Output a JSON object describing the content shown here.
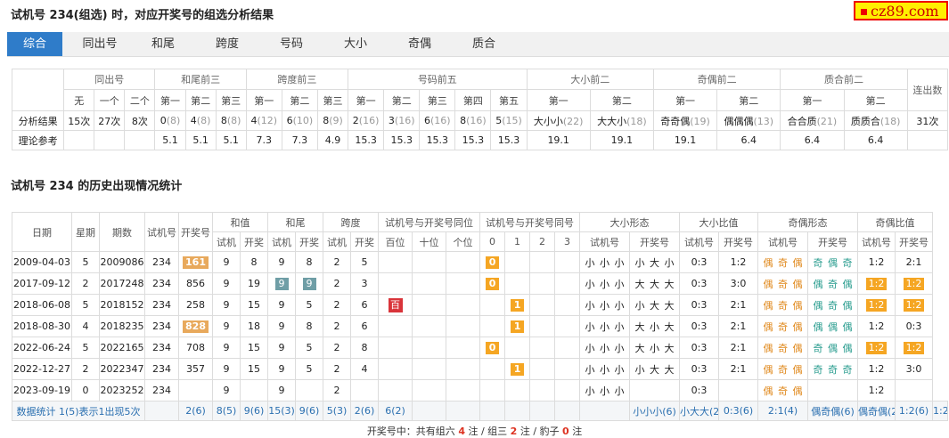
{
  "header": {
    "title": "试机号 234(组选) 时，对应开奖号的组选分析结果",
    "logo": "cz89.com"
  },
  "tabs": [
    "综合",
    "同出号",
    "和尾",
    "跨度",
    "号码",
    "大小",
    "奇偶",
    "质合"
  ],
  "analysis": {
    "groups": [
      "同出号",
      "和尾前三",
      "跨度前三",
      "号码前五",
      "大小前二",
      "奇偶前二",
      "质合前二",
      "连出数"
    ],
    "sub": [
      "无",
      "一个",
      "二个",
      "第一",
      "第二",
      "第三",
      "第一",
      "第二",
      "第三",
      "第一",
      "第二",
      "第三",
      "第四",
      "第五",
      "第一",
      "第二",
      "第一",
      "第二",
      "第一",
      "第二"
    ],
    "row1_label": "分析结果",
    "row1": [
      {
        "v": "15次"
      },
      {
        "v": "27次"
      },
      {
        "v": "8次"
      },
      {
        "v": "0",
        "c": "(8)"
      },
      {
        "v": "4",
        "c": "(8)"
      },
      {
        "v": "8",
        "c": "(8)"
      },
      {
        "v": "4",
        "c": "(12)"
      },
      {
        "v": "6",
        "c": "(10)"
      },
      {
        "v": "8",
        "c": "(9)"
      },
      {
        "v": "2",
        "c": "(16)"
      },
      {
        "v": "3",
        "c": "(16)"
      },
      {
        "v": "6",
        "c": "(16)"
      },
      {
        "v": "8",
        "c": "(16)"
      },
      {
        "v": "5",
        "c": "(15)"
      },
      {
        "v": "大小小",
        "c": "(22)"
      },
      {
        "v": "大大小",
        "c": "(18)"
      },
      {
        "v": "奇奇偶",
        "c": "(19)"
      },
      {
        "v": "偶偶偶",
        "c": "(13)"
      },
      {
        "v": "合合质",
        "c": "(21)"
      },
      {
        "v": "质质合",
        "c": "(18)"
      },
      {
        "v": "31次"
      }
    ],
    "row2_label": "理论参考",
    "row2": [
      "",
      "",
      "",
      "5.1",
      "5.1",
      "5.1",
      "7.3",
      "7.3",
      "4.9",
      "15.3",
      "15.3",
      "15.3",
      "15.3",
      "15.3",
      "19.1",
      "19.1",
      "19.1",
      "6.4",
      "6.4",
      "6.4",
      ""
    ]
  },
  "history": {
    "title": "试机号 234 的历史出现情况统计",
    "h_top": [
      "日期",
      "星期",
      "期数",
      "试机号",
      "开奖号",
      "和值",
      "和尾",
      "跨度",
      "试机号与开奖号同位",
      "试机号与开奖号同号",
      "大小形态",
      "大小比值",
      "奇偶形态",
      "奇偶比值"
    ],
    "h_sub": [
      "试机",
      "开奖",
      "试机",
      "开奖",
      "试机",
      "开奖",
      "百位",
      "十位",
      "个位",
      "0",
      "1",
      "2",
      "3",
      "试机号",
      "开奖号",
      "试机号",
      "开奖号",
      "试机号",
      "开奖号",
      "试机号",
      "开奖号"
    ],
    "rows": [
      {
        "date": "2009-04-03",
        "wk": "5",
        "issue": "2009086",
        "test": "234",
        "draw": "161",
        "drawHi": true,
        "hs": "9",
        "hk": "8",
        "ws": "9",
        "wk2": "8",
        "wsHi": false,
        "ks": "2",
        "kk": "5",
        "pos": "",
        "same": 0,
        "dxs": "小 小 小",
        "dxk": "小 大 小",
        "dbs": "0:3",
        "dbk": "1:2",
        "jos": "偶 奇 偶",
        "jok": "奇 偶 奇",
        "jbs": "1:2",
        "jbk": "2:1",
        "jbsHi": false,
        "jbkHi": false
      },
      {
        "date": "2017-09-12",
        "wk": "2",
        "issue": "2017248",
        "test": "234",
        "draw": "856",
        "drawHi": false,
        "hs": "9",
        "hk": "19",
        "ws": "9",
        "wk2": "9",
        "wsHi": true,
        "ks": "2",
        "kk": "3",
        "pos": "",
        "same": 0,
        "dxs": "小 小 小",
        "dxk": "大 大 大",
        "dbs": "0:3",
        "dbk": "3:0",
        "jos": "偶 奇 偶",
        "jok": "偶 奇 偶",
        "jbs": "1:2",
        "jbk": "1:2",
        "jbsHi": true,
        "jbkHi": true
      },
      {
        "date": "2018-06-08",
        "wk": "5",
        "issue": "2018152",
        "test": "234",
        "draw": "258",
        "drawHi": false,
        "hs": "9",
        "hk": "15",
        "ws": "9",
        "wk2": "5",
        "wsHi": false,
        "ks": "2",
        "kk": "6",
        "pos": "百",
        "same": 1,
        "dxs": "小 小 小",
        "dxk": "小 大 大",
        "dbs": "0:3",
        "dbk": "2:1",
        "jos": "偶 奇 偶",
        "jok": "偶 奇 偶",
        "jbs": "1:2",
        "jbk": "1:2",
        "jbsHi": true,
        "jbkHi": true
      },
      {
        "date": "2018-08-30",
        "wk": "4",
        "issue": "2018235",
        "test": "234",
        "draw": "828",
        "drawHi": true,
        "hs": "9",
        "hk": "18",
        "ws": "9",
        "wk2": "8",
        "wsHi": false,
        "ks": "2",
        "kk": "6",
        "pos": "",
        "same": 1,
        "dxs": "小 小 小",
        "dxk": "大 小 大",
        "dbs": "0:3",
        "dbk": "2:1",
        "jos": "偶 奇 偶",
        "jok": "偶 偶 偶",
        "jbs": "1:2",
        "jbk": "0:3",
        "jbsHi": false,
        "jbkHi": false
      },
      {
        "date": "2022-06-24",
        "wk": "5",
        "issue": "2022165",
        "test": "234",
        "draw": "708",
        "drawHi": false,
        "hs": "9",
        "hk": "15",
        "ws": "9",
        "wk2": "5",
        "wsHi": false,
        "ks": "2",
        "kk": "8",
        "pos": "",
        "same": 0,
        "dxs": "小 小 小",
        "dxk": "大 小 大",
        "dbs": "0:3",
        "dbk": "2:1",
        "jos": "偶 奇 偶",
        "jok": "奇 偶 偶",
        "jbs": "1:2",
        "jbk": "1:2",
        "jbsHi": true,
        "jbkHi": true
      },
      {
        "date": "2022-12-27",
        "wk": "2",
        "issue": "2022347",
        "test": "234",
        "draw": "357",
        "drawHi": false,
        "hs": "9",
        "hk": "15",
        "ws": "9",
        "wk2": "5",
        "wsHi": false,
        "ks": "2",
        "kk": "4",
        "pos": "",
        "same": 1,
        "dxs": "小 小 小",
        "dxk": "小 大 大",
        "dbs": "0:3",
        "dbk": "2:1",
        "jos": "偶 奇 偶",
        "jok": "奇 奇 奇",
        "jbs": "1:2",
        "jbk": "3:0",
        "jbsHi": false,
        "jbkHi": false
      },
      {
        "date": "2023-09-19",
        "wk": "0",
        "issue": "2023252",
        "test": "234",
        "draw": "",
        "drawHi": false,
        "hs": "9",
        "hk": "",
        "ws": "9",
        "wk2": "",
        "wsHi": false,
        "ks": "2",
        "kk": "",
        "pos": "",
        "same": -1,
        "dxs": "小 小 小",
        "dxk": "",
        "dbs": "0:3",
        "dbk": "",
        "jos": "偶 奇 偶",
        "jok": "",
        "jbs": "1:2",
        "jbk": "",
        "jbsHi": false,
        "jbkHi": false
      }
    ],
    "stats": [
      "数据统计 1(5)表示1出现5次",
      "2(6)",
      "8(5)",
      "9(6)",
      "15(3)",
      "9(6)",
      "5(3)",
      "2(6)",
      "6(2)",
      "",
      "",
      "",
      "",
      "",
      "",
      "",
      "",
      "小小小(6)",
      "小大大(2)",
      "0:3(6)",
      "2:1(4)",
      "偶奇偶(6)",
      "偶奇偶(2)",
      "1:2(6)",
      "1:2(3)"
    ]
  },
  "footer": {
    "p1": "开奖号中：共有组六",
    "n1": "4",
    "p2": "注 / 组三",
    "n2": "2",
    "p3": "注 / 豹子",
    "n3": "0",
    "p4": "注"
  }
}
